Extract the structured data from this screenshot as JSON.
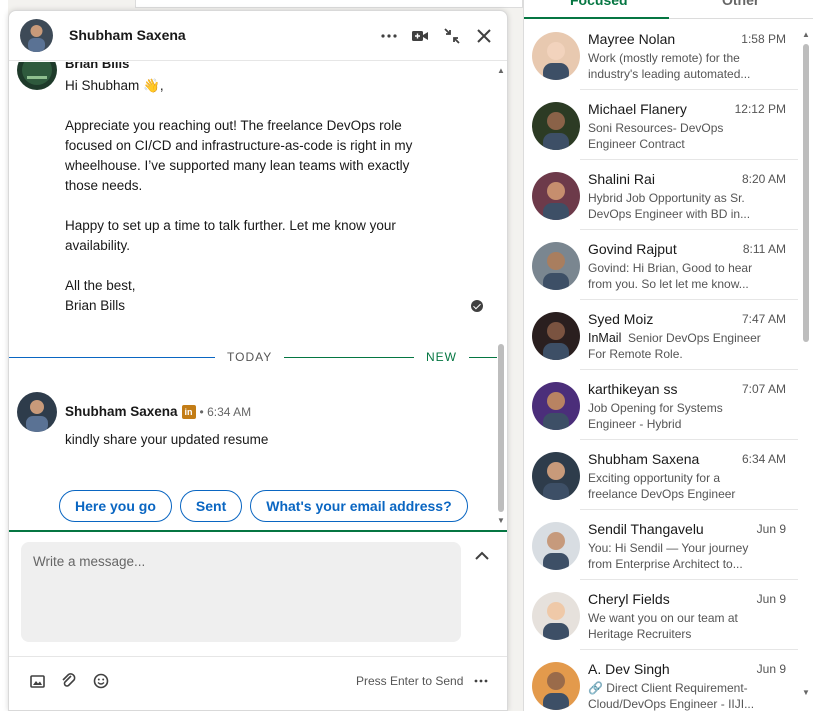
{
  "chat": {
    "title": "Shubham Saxena",
    "top_sender_name": "Brian Bills",
    "message1": "Hi Shubham 👋,\n\nAppreciate you reaching out! The freelance DevOps role focused on CI/CD and infrastructure-as-code is right in my wheelhouse. I’ve supported many lean teams with exactly those needs.\n\nHappy to set up a time to talk further. Let me know your availability.\n\nAll the best,\nBrian Bills",
    "divider_today": "TODAY",
    "divider_new": "NEW",
    "message2": {
      "sender": "Shubham Saxena",
      "badge": "in",
      "time": "• 6:34 AM",
      "text": "kindly share your updated resume"
    },
    "quick_replies": [
      "Here you go",
      "Sent",
      "What's your email address?"
    ],
    "compose_placeholder": "Write a message...",
    "press_enter": "Press Enter to Send",
    "accent_color": "#0a66c2",
    "focus_color": "#057642"
  },
  "inbox": {
    "tabs": [
      "Focused",
      "Other"
    ],
    "conversations": [
      {
        "name": "Mayree Nolan",
        "time": "1:58 PM",
        "preview": "Work (mostly remote) for the industry's leading automated..."
      },
      {
        "name": "Michael Flanery",
        "time": "12:12 PM",
        "preview": "Soni Resources- DevOps Engineer Contract"
      },
      {
        "name": "Shalini Rai",
        "time": "8:20 AM",
        "preview": "Hybrid Job Opportunity as Sr. DevOps Engineer with BD in..."
      },
      {
        "name": "Govind Rajput",
        "time": "8:11 AM",
        "preview": "Govind: Hi Brian, Good to hear from you. So let let me know..."
      },
      {
        "name": "Syed Moiz",
        "time": "7:47 AM",
        "tag": "InMail",
        "preview": "Senior DevOps Engineer For Remote Role."
      },
      {
        "name": "karthikeyan ss",
        "time": "7:07 AM",
        "preview": "Job Opening for Systems Engineer - Hybrid"
      },
      {
        "name": "Shubham Saxena",
        "time": "6:34 AM",
        "preview": "Exciting opportunity for a freelance DevOps Engineer"
      },
      {
        "name": "Sendil Thangavelu",
        "time": "Jun 9",
        "preview": "You: Hi Sendil — Your journey from Enterprise Architect to..."
      },
      {
        "name": "Cheryl Fields",
        "time": "Jun 9",
        "preview": "We want you on our team at Heritage Recruiters"
      },
      {
        "name": "A. Dev Singh",
        "time": "Jun 9",
        "preview": "🔗 Direct Client Requirement- Cloud/DevOps Engineer - IIJI..."
      }
    ]
  },
  "icons": [
    "more-icon",
    "video-call-icon",
    "minimize-icon",
    "close-icon",
    "image-icon",
    "attachment-icon",
    "emoji-icon",
    "expand-icon"
  ]
}
